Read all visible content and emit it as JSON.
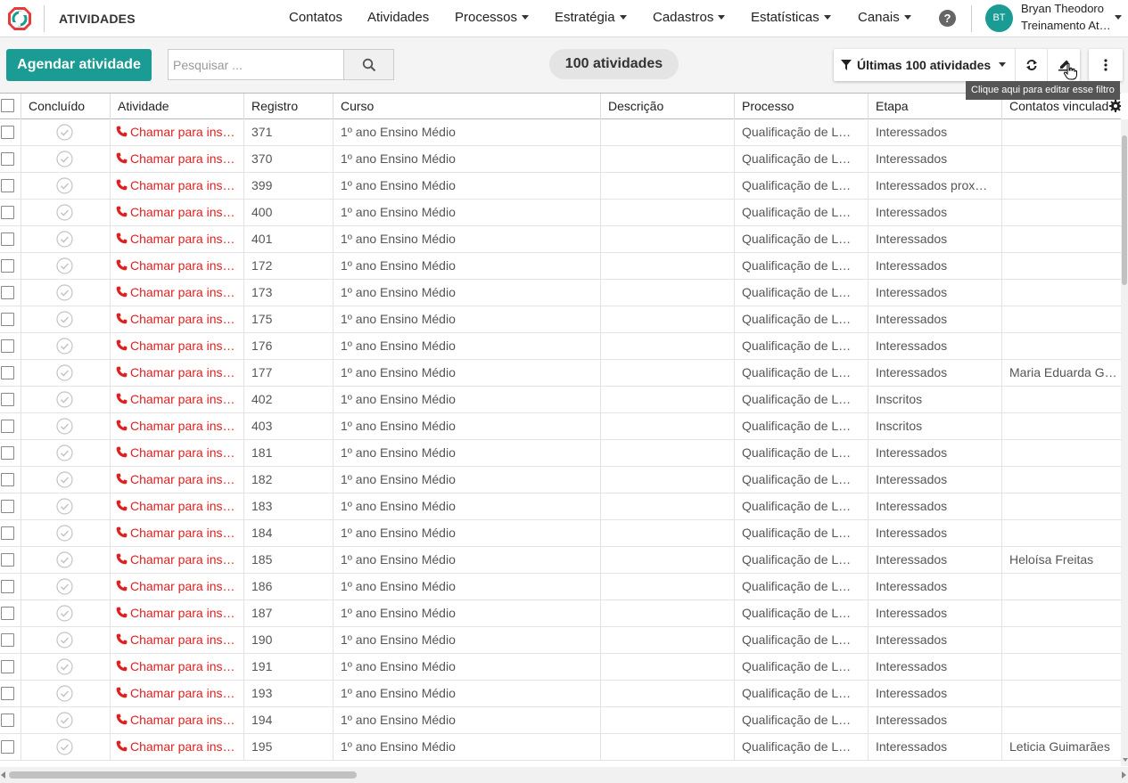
{
  "app": {
    "title": "ATIVIDADES"
  },
  "nav": {
    "items": [
      {
        "label": "Contatos",
        "dropdown": false
      },
      {
        "label": "Atividades",
        "dropdown": false
      },
      {
        "label": "Processos",
        "dropdown": true
      },
      {
        "label": "Estratégia",
        "dropdown": true
      },
      {
        "label": "Cadastros",
        "dropdown": true
      },
      {
        "label": "Estatísticas",
        "dropdown": true
      },
      {
        "label": "Canais",
        "dropdown": true
      }
    ],
    "help_label": "?"
  },
  "user": {
    "initials": "BT",
    "name": "Bryan Theodoro",
    "org": "Treinamento At…",
    "avatar_color": "#1a9b93"
  },
  "toolbar": {
    "schedule_label": "Agendar atividade",
    "search_placeholder": "Pesquisar ...",
    "search_value": "",
    "count_label": "100 atividades",
    "filter_label": "Últimas 100 atividades",
    "tooltip": "Clique aqui para editar esse filtro"
  },
  "colors": {
    "primary": "#1a9b93",
    "activity_red": "#e02020"
  },
  "table": {
    "columns": [
      "",
      "Concluído",
      "Atividade",
      "Registro",
      "Curso",
      "Descrição",
      "Processo",
      "Etapa",
      "Contatos vinculados"
    ],
    "rows": [
      {
        "activity": "Chamar para ins…",
        "registro": "371",
        "curso": "1º ano Ensino Médio",
        "descricao": "",
        "processo": "Qualificação de L…",
        "etapa": "Interessados",
        "contatos": ""
      },
      {
        "activity": "Chamar para ins…",
        "registro": "370",
        "curso": "1º ano Ensino Médio",
        "descricao": "",
        "processo": "Qualificação de L…",
        "etapa": "Interessados",
        "contatos": ""
      },
      {
        "activity": "Chamar para ins…",
        "registro": "399",
        "curso": "1º ano Ensino Médio",
        "descricao": "",
        "processo": "Qualificação de L…",
        "etapa": "Interessados prox…",
        "contatos": ""
      },
      {
        "activity": "Chamar para ins…",
        "registro": "400",
        "curso": "1º ano Ensino Médio",
        "descricao": "",
        "processo": "Qualificação de L…",
        "etapa": "Interessados",
        "contatos": ""
      },
      {
        "activity": "Chamar para ins…",
        "registro": "401",
        "curso": "1º ano Ensino Médio",
        "descricao": "",
        "processo": "Qualificação de L…",
        "etapa": "Interessados",
        "contatos": ""
      },
      {
        "activity": "Chamar para ins…",
        "registro": "172",
        "curso": "1º ano Ensino Médio",
        "descricao": "",
        "processo": "Qualificação de L…",
        "etapa": "Interessados",
        "contatos": ""
      },
      {
        "activity": "Chamar para ins…",
        "registro": "173",
        "curso": "1º ano Ensino Médio",
        "descricao": "",
        "processo": "Qualificação de L…",
        "etapa": "Interessados",
        "contatos": ""
      },
      {
        "activity": "Chamar para ins…",
        "registro": "175",
        "curso": "1º ano Ensino Médio",
        "descricao": "",
        "processo": "Qualificação de L…",
        "etapa": "Interessados",
        "contatos": ""
      },
      {
        "activity": "Chamar para ins…",
        "registro": "176",
        "curso": "1º ano Ensino Médio",
        "descricao": "",
        "processo": "Qualificação de L…",
        "etapa": "Interessados",
        "contatos": ""
      },
      {
        "activity": "Chamar para ins…",
        "registro": "177",
        "curso": "1º ano Ensino Médio",
        "descricao": "",
        "processo": "Qualificação de L…",
        "etapa": "Interessados",
        "contatos": "Maria Eduarda Gonç"
      },
      {
        "activity": "Chamar para ins…",
        "registro": "402",
        "curso": "1º ano Ensino Médio",
        "descricao": "",
        "processo": "Qualificação de L…",
        "etapa": "Inscritos",
        "contatos": ""
      },
      {
        "activity": "Chamar para ins…",
        "registro": "403",
        "curso": "1º ano Ensino Médio",
        "descricao": "",
        "processo": "Qualificação de L…",
        "etapa": "Inscritos",
        "contatos": ""
      },
      {
        "activity": "Chamar para ins…",
        "registro": "181",
        "curso": "1º ano Ensino Médio",
        "descricao": "",
        "processo": "Qualificação de L…",
        "etapa": "Interessados",
        "contatos": ""
      },
      {
        "activity": "Chamar para ins…",
        "registro": "182",
        "curso": "1º ano Ensino Médio",
        "descricao": "",
        "processo": "Qualificação de L…",
        "etapa": "Interessados",
        "contatos": ""
      },
      {
        "activity": "Chamar para ins…",
        "registro": "183",
        "curso": "1º ano Ensino Médio",
        "descricao": "",
        "processo": "Qualificação de L…",
        "etapa": "Interessados",
        "contatos": ""
      },
      {
        "activity": "Chamar para ins…",
        "registro": "184",
        "curso": "1º ano Ensino Médio",
        "descricao": "",
        "processo": "Qualificação de L…",
        "etapa": "Interessados",
        "contatos": ""
      },
      {
        "activity": "Chamar para ins…",
        "registro": "185",
        "curso": "1º ano Ensino Médio",
        "descricao": "",
        "processo": "Qualificação de L…",
        "etapa": "Interessados",
        "contatos": "Heloísa Freitas"
      },
      {
        "activity": "Chamar para ins…",
        "registro": "186",
        "curso": "1º ano Ensino Médio",
        "descricao": "",
        "processo": "Qualificação de L…",
        "etapa": "Interessados",
        "contatos": ""
      },
      {
        "activity": "Chamar para ins…",
        "registro": "187",
        "curso": "1º ano Ensino Médio",
        "descricao": "",
        "processo": "Qualificação de L…",
        "etapa": "Interessados",
        "contatos": ""
      },
      {
        "activity": "Chamar para ins…",
        "registro": "190",
        "curso": "1º ano Ensino Médio",
        "descricao": "",
        "processo": "Qualificação de L…",
        "etapa": "Interessados",
        "contatos": ""
      },
      {
        "activity": "Chamar para ins…",
        "registro": "191",
        "curso": "1º ano Ensino Médio",
        "descricao": "",
        "processo": "Qualificação de L…",
        "etapa": "Interessados",
        "contatos": ""
      },
      {
        "activity": "Chamar para ins…",
        "registro": "193",
        "curso": "1º ano Ensino Médio",
        "descricao": "",
        "processo": "Qualificação de L…",
        "etapa": "Interessados",
        "contatos": ""
      },
      {
        "activity": "Chamar para ins…",
        "registro": "194",
        "curso": "1º ano Ensino Médio",
        "descricao": "",
        "processo": "Qualificação de L…",
        "etapa": "Interessados",
        "contatos": ""
      },
      {
        "activity": "Chamar para ins…",
        "registro": "195",
        "curso": "1º ano Ensino Médio",
        "descricao": "",
        "processo": "Qualificação de L…",
        "etapa": "Interessados",
        "contatos": "Leticia Guimarães"
      }
    ]
  }
}
